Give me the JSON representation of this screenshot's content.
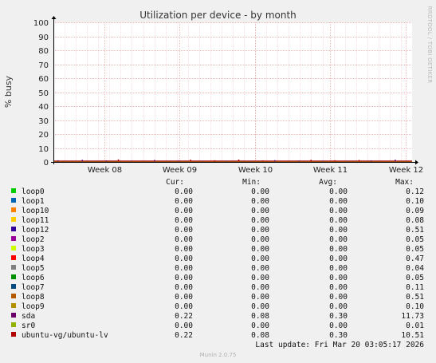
{
  "chart_data": {
    "type": "line",
    "title": "Utilization per device - by month",
    "ylabel": "% busy",
    "xlabel": "",
    "x_ticks": [
      "Week 08",
      "Week 09",
      "Week 10",
      "Week 11",
      "Week 12"
    ],
    "y_ticks": [
      "0",
      "10",
      "20",
      "30",
      "40",
      "50",
      "60",
      "70",
      "80",
      "90",
      "100"
    ],
    "ylim": [
      0,
      100
    ],
    "grid": true,
    "legend_placement": "bottom",
    "columns": [
      "Cur:",
      "Min:",
      "Avg:",
      "Max:"
    ],
    "series": [
      {
        "name": "loop0",
        "color": "#00cc00",
        "cur": "0.00",
        "min": "0.00",
        "avg": "0.00",
        "max": "0.12"
      },
      {
        "name": "loop1",
        "color": "#0066b3",
        "cur": "0.00",
        "min": "0.00",
        "avg": "0.00",
        "max": "0.10"
      },
      {
        "name": "loop10",
        "color": "#ff8000",
        "cur": "0.00",
        "min": "0.00",
        "avg": "0.00",
        "max": "0.09"
      },
      {
        "name": "loop11",
        "color": "#ffcc00",
        "cur": "0.00",
        "min": "0.00",
        "avg": "0.00",
        "max": "0.08"
      },
      {
        "name": "loop12",
        "color": "#330099",
        "cur": "0.00",
        "min": "0.00",
        "avg": "0.00",
        "max": "0.51"
      },
      {
        "name": "loop2",
        "color": "#990099",
        "cur": "0.00",
        "min": "0.00",
        "avg": "0.00",
        "max": "0.05"
      },
      {
        "name": "loop3",
        "color": "#ccff00",
        "cur": "0.00",
        "min": "0.00",
        "avg": "0.00",
        "max": "0.05"
      },
      {
        "name": "loop4",
        "color": "#ff0000",
        "cur": "0.00",
        "min": "0.00",
        "avg": "0.00",
        "max": "0.47"
      },
      {
        "name": "loop5",
        "color": "#808080",
        "cur": "0.00",
        "min": "0.00",
        "avg": "0.00",
        "max": "0.04"
      },
      {
        "name": "loop6",
        "color": "#008f00",
        "cur": "0.00",
        "min": "0.00",
        "avg": "0.00",
        "max": "0.05"
      },
      {
        "name": "loop7",
        "color": "#00487d",
        "cur": "0.00",
        "min": "0.00",
        "avg": "0.00",
        "max": "0.11"
      },
      {
        "name": "loop8",
        "color": "#b35a00",
        "cur": "0.00",
        "min": "0.00",
        "avg": "0.00",
        "max": "0.51"
      },
      {
        "name": "loop9",
        "color": "#b38f00",
        "cur": "0.00",
        "min": "0.00",
        "avg": "0.00",
        "max": "0.10"
      },
      {
        "name": "sda",
        "color": "#6b006b",
        "cur": "0.22",
        "min": "0.08",
        "avg": "0.30",
        "max": "11.73"
      },
      {
        "name": "sr0",
        "color": "#8fb300",
        "cur": "0.00",
        "min": "0.00",
        "avg": "0.00",
        "max": "0.01"
      },
      {
        "name": "ubuntu-vg/ubuntu-lv",
        "color": "#b30000",
        "cur": "0.22",
        "min": "0.08",
        "avg": "0.30",
        "max": "10.51"
      }
    ],
    "sda_spikes": [
      0.9,
      0.4,
      1.2,
      0.3,
      0.8,
      1.5,
      0.5,
      0.6,
      1.1,
      0.4,
      0.7,
      1.3,
      0.5,
      0.9,
      0.6,
      1.4,
      0.4,
      0.8,
      1.0,
      0.5,
      0.7,
      1.2,
      0.6,
      0.9,
      0.4,
      1.1,
      0.8,
      0.5,
      1.3,
      0.6
    ]
  },
  "side_label": "RRDTOOL / TOBI OETIKER",
  "last_update": "Last update: Fri Mar 20 03:05:17 2026",
  "footer": "Munin 2.0.75"
}
